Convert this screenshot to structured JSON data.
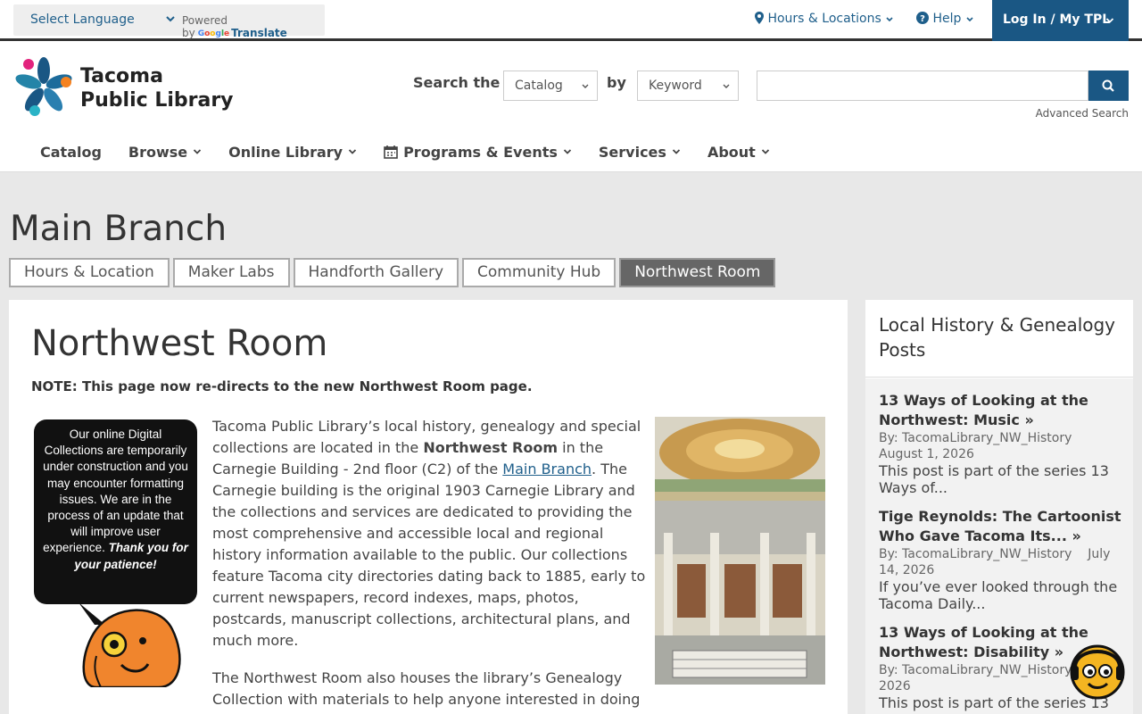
{
  "utility": {
    "language": "Select Language",
    "powered_by": "Powered by",
    "google": "Google",
    "translate": "Translate",
    "hours": "Hours & Locations",
    "help": "Help",
    "login": "Log In / My TPL"
  },
  "header": {
    "logo_line1": "Tacoma",
    "logo_line2": "Public Library",
    "search_the": "Search the",
    "catalog_select": "Catalog",
    "by": "by",
    "keyword_select": "Keyword",
    "search_placeholder": "",
    "advanced_search": "Advanced Search"
  },
  "nav": {
    "catalog": "Catalog",
    "browse": "Browse",
    "online": "Online Library",
    "programs": "Programs & Events",
    "services": "Services",
    "about": "About"
  },
  "branch": {
    "title": "Main Branch",
    "tabs": [
      "Hours & Location",
      "Maker Labs",
      "Handforth Gallery",
      "Community Hub",
      "Northwest Room"
    ]
  },
  "main": {
    "title": "Northwest Room",
    "note": "NOTE: This page now re-directs to the new Northwest Room page.",
    "bubble_text": "Our online Digital Collections are temporarily under construction and you may encounter formatting issues. We are in the process of an update that will improve user experience.",
    "bubble_thanks": "Thank you for your patience!",
    "p1_a": "Tacoma Public Library’s local history, genealogy and special collections are located in the ",
    "p1_bold": "Northwest Room",
    "p1_b": "  in the Carnegie Building - 2nd floor (C2) of the ",
    "p1_link": "Main Branch",
    "p1_c": ". The Carnegie building is the original 1903 Carnegie Library and the collections and services are dedicated to providing the most comprehensive and accessible local and regional history information available to the public. Our collections feature Tacoma city directories dating back to 1885, early to current newspapers, record indexes, maps, photos, postcards, manuscript collections, architectural plans, and much more.",
    "p2": "The Northwest Room also houses the library’s Genealogy Collection with materials to help anyone interested in doing genealogical research. In addition to a rich selection of local"
  },
  "sidebar": {
    "title": "Local History & Genealogy Posts",
    "posts": [
      {
        "title": "13 Ways of Looking at the Northwest: Music",
        "by": "By: TacomaLibrary_NW_History",
        "date": "August 1, 2026",
        "excerpt": "This post is part of the series 13 Ways of..."
      },
      {
        "title": "Tige Reynolds: The Cartoonist Who Gave Tacoma Its...",
        "by": "By: TacomaLibrary_NW_History",
        "date": "July 14, 2026",
        "excerpt": "If you’ve ever looked through the Tacoma Daily..."
      },
      {
        "title": "13 Ways of Looking at the Northwest: Disability",
        "by": "By: TacomaLibrary_NW_History",
        "date": "2026",
        "excerpt": "This post is part of the series 13"
      }
    ]
  },
  "colors": {
    "brand_blue": "#1a5784",
    "link_blue": "#1f5f8b",
    "active_tab": "#666666"
  }
}
